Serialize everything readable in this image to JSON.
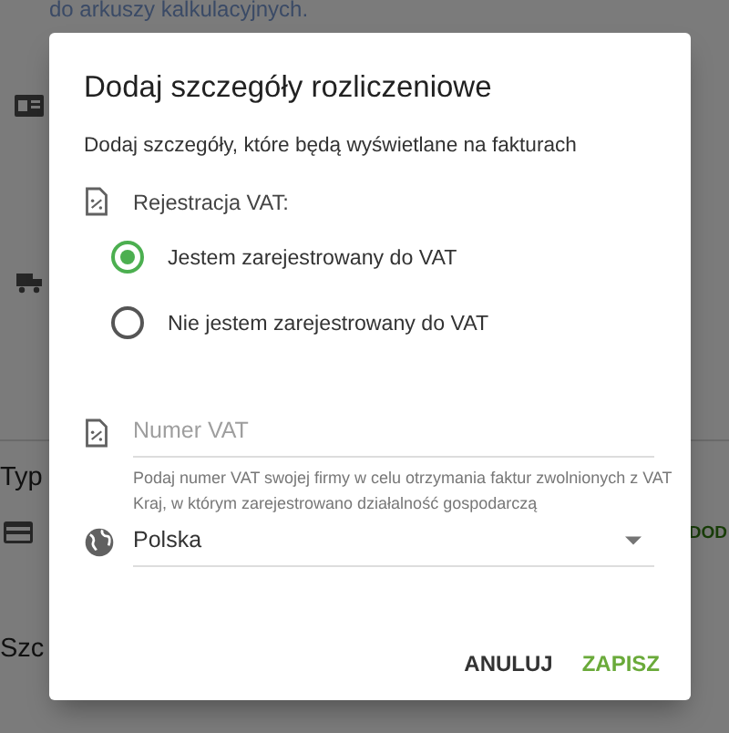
{
  "background": {
    "note": "do arkuszy kalkulacyjnych.",
    "section_title": "Typ",
    "action": "DOD",
    "bottom_title": "Szc"
  },
  "dialog": {
    "title": "Dodaj szczegóły rozliczeniowe",
    "subtitle": "Dodaj szczegóły, które będą wyświetlane na fakturach",
    "vat_label": "Rejestracja VAT:",
    "options": [
      {
        "label": "Jestem zarejestrowany do VAT",
        "selected": true
      },
      {
        "label": "Nie jestem zarejestrowany do VAT",
        "selected": false
      }
    ],
    "vat_field": {
      "placeholder": "Numer VAT",
      "hint": "Podaj numer VAT swojej firmy w celu otrzymania faktur zwolnionych z VAT"
    },
    "country": {
      "label": "Kraj, w którym zarejestrowano działalność gospodarczą",
      "value": "Polska"
    },
    "buttons": [
      {
        "label": "ANULUJ",
        "kind": "cancel"
      },
      {
        "label": "ZAPISZ",
        "kind": "primary"
      }
    ]
  }
}
